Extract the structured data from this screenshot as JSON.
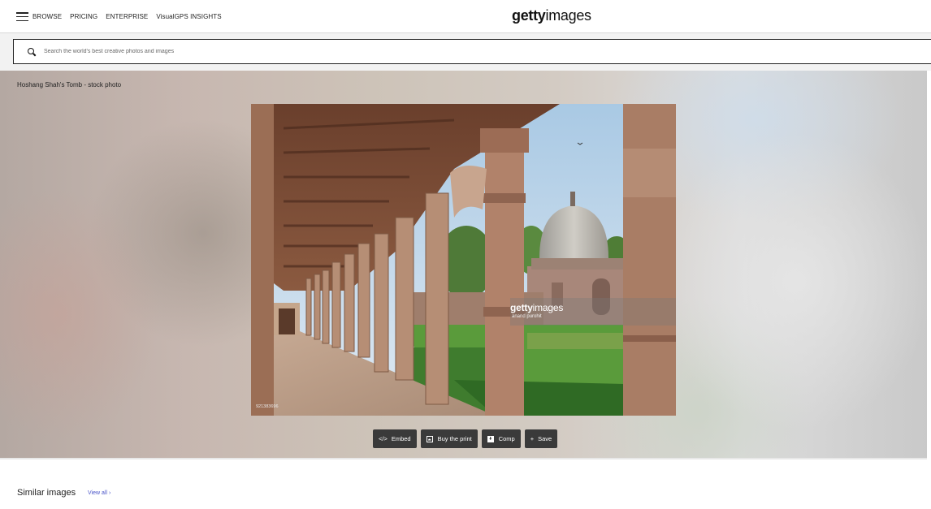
{
  "header": {
    "nav": [
      "BROWSE",
      "PRICING",
      "ENTERPRISE",
      "VisualGPS INSIGHTS"
    ],
    "logo_bold": "getty",
    "logo_light": "images"
  },
  "search": {
    "placeholder": "Search the world's best creative photos and images"
  },
  "asset": {
    "title": "Hoshang Shah's Tomb - stock photo",
    "watermark_bold": "getty",
    "watermark_light": "images",
    "credit": "anand purohit",
    "id": "921383696"
  },
  "actions": {
    "embed": "Embed",
    "buy_print": "Buy the print",
    "comp": "Comp",
    "save": "Save"
  },
  "similar": {
    "heading": "Similar images",
    "view_all": "View all"
  }
}
